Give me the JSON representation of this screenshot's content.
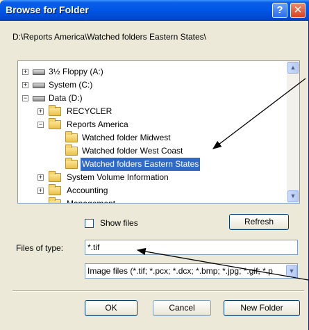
{
  "dialog": {
    "title": "Browse for Folder",
    "help_glyph": "?",
    "close_glyph": "✕"
  },
  "path": "D:\\Reports America\\Watched folders Eastern States\\",
  "tree": {
    "items": [
      {
        "label": "3½ Floppy (A:)",
        "type": "drive",
        "expander": "+"
      },
      {
        "label": "System (C:)",
        "type": "drive",
        "expander": "+"
      },
      {
        "label": "Data (D:)",
        "type": "drive",
        "expander": "−"
      },
      {
        "label": "RECYCLER",
        "type": "folder",
        "expander": "+"
      },
      {
        "label": "Reports America",
        "type": "folder",
        "expander": "−"
      },
      {
        "label": "Watched folder Midwest",
        "type": "folder",
        "expander": ""
      },
      {
        "label": "Watched folder West Coast",
        "type": "folder",
        "expander": ""
      },
      {
        "label": "Watched folders Eastern States",
        "type": "folder-open",
        "expander": "",
        "selected": true
      },
      {
        "label": "System Volume Information",
        "type": "folder",
        "expander": "+"
      },
      {
        "label": "Accounting",
        "type": "folder",
        "expander": "+"
      },
      {
        "label": "Management",
        "type": "folder",
        "expander": ""
      }
    ],
    "scroll_up": "▲",
    "scroll_down": "▼"
  },
  "show_files_label": "Show files",
  "refresh_label": "Refresh",
  "files_of_type_label": "Files of type:",
  "files_of_type_value": "*.tif",
  "file_types_selected": "Image files (*.tif; *.pcx; *.dcx; *.bmp; *.jpg; *.gif; *.p",
  "select_arrow": "▼",
  "ok_label": "OK",
  "cancel_label": "Cancel",
  "new_folder_label": "New Folder",
  "colors": {
    "titlebar": "#0056e6",
    "selection": "#316ac5",
    "dialog_bg": "#ece9d8"
  }
}
